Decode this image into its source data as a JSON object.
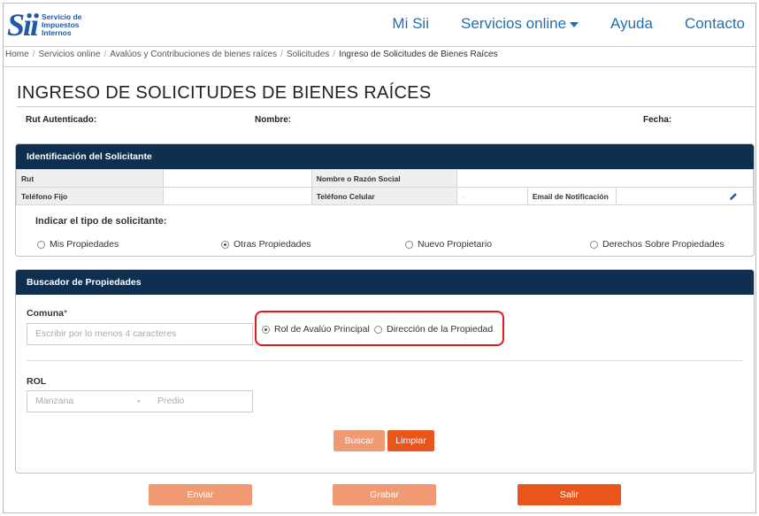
{
  "header": {
    "logo_mark": "Sii",
    "logo_lines": [
      "Servicio de",
      "Impuestos",
      "Internos"
    ],
    "nav": [
      "Mi Sii",
      "Servicios online",
      "Ayuda",
      "Contacto"
    ]
  },
  "breadcrumb": [
    "Home",
    "Servicios online",
    "Avalúos y Contribuciones de bienes raíces",
    "Solicitudes",
    "Ingreso de Solicitudes de Bienes Raíces"
  ],
  "page_title": "INGRESO DE SOLICITUDES DE BIENES RAÍCES",
  "info": {
    "rut": "Rut Autenticado:",
    "nombre": "Nombre:",
    "fecha": "Fecha:"
  },
  "solicitante": {
    "header": "Identificación del Solicitante",
    "rut_label": "Rut",
    "rut_value": "",
    "nombre_label": "Nombre o Razón Social",
    "nombre_value": "",
    "tel_fijo_label": "Teléfono Fijo",
    "tel_fijo_value": "",
    "tel_cel_label": "Teléfono Celular",
    "tel_cel_value": "-",
    "email_label": "Email de Notificación",
    "email_value": "",
    "question": "Indicar el tipo de solicitante:",
    "options": [
      "Mis Propiedades",
      "Otras Propiedades",
      "Nuevo Propietario",
      "Derechos Sobre Propiedades"
    ],
    "selected": 1
  },
  "buscador": {
    "header": "Buscador de Propiedades",
    "comuna_label": "Comuna",
    "comuna_required": "*",
    "comuna_placeholder": "Escribir por lo menos 4 caracteres",
    "search_options": [
      "Rol de Avalúo Principal",
      "Dirección de la Propiedad"
    ],
    "search_selected": 0,
    "rol_label": "ROL",
    "manzana_placeholder": "Manzana",
    "dash": "-",
    "predio_placeholder": "Predio",
    "buscar": "Buscar",
    "limpiar": "Limpiar"
  },
  "actions": {
    "enviar": "Enviar",
    "grabar": "Grabar",
    "salir": "Salir"
  },
  "colors": {
    "navy": "#0e2f50",
    "brand_blue": "#1f6fb9",
    "orange": "#e8561e",
    "orange_light": "#f09a74",
    "highlight": "#e3181b"
  }
}
